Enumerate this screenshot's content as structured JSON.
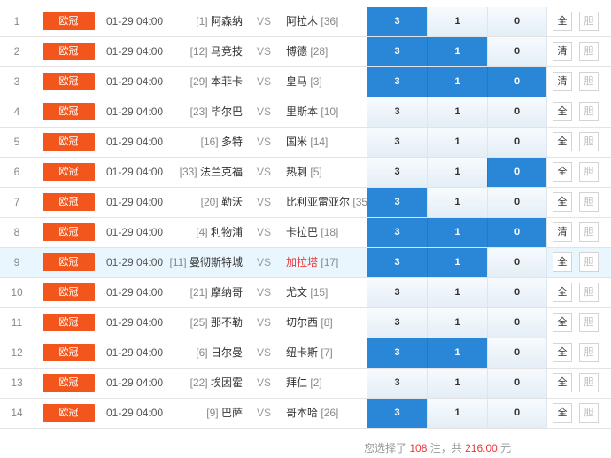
{
  "rows": [
    {
      "idx": "1",
      "league": "欧冠",
      "time": "01-29 04:00",
      "home_rank": "[1]",
      "home": "阿森纳",
      "vs": "VS",
      "away": "阿拉木",
      "away_rank": "[36]",
      "o3": "3",
      "o1": "1",
      "o0": "0",
      "sel": [
        true,
        false,
        false
      ],
      "btn": "全",
      "btn2": "胆",
      "hl": false,
      "away_red": false
    },
    {
      "idx": "2",
      "league": "欧冠",
      "time": "01-29 04:00",
      "home_rank": "[12]",
      "home": "马竞技",
      "vs": "VS",
      "away": "博德",
      "away_rank": "[28]",
      "o3": "3",
      "o1": "1",
      "o0": "0",
      "sel": [
        true,
        true,
        false
      ],
      "btn": "清",
      "btn2": "胆",
      "hl": false,
      "away_red": false
    },
    {
      "idx": "3",
      "league": "欧冠",
      "time": "01-29 04:00",
      "home_rank": "[29]",
      "home": "本菲卡",
      "vs": "VS",
      "away": "皇马",
      "away_rank": "[3]",
      "o3": "3",
      "o1": "1",
      "o0": "0",
      "sel": [
        true,
        true,
        true
      ],
      "btn": "清",
      "btn2": "胆",
      "hl": false,
      "away_red": false
    },
    {
      "idx": "4",
      "league": "欧冠",
      "time": "01-29 04:00",
      "home_rank": "[23]",
      "home": "毕尔巴",
      "vs": "VS",
      "away": "里斯本",
      "away_rank": "[10]",
      "o3": "3",
      "o1": "1",
      "o0": "0",
      "sel": [
        false,
        false,
        false
      ],
      "btn": "全",
      "btn2": "胆",
      "hl": false,
      "away_red": false
    },
    {
      "idx": "5",
      "league": "欧冠",
      "time": "01-29 04:00",
      "home_rank": "[16]",
      "home": "多特",
      "vs": "VS",
      "away": "国米",
      "away_rank": "[14]",
      "o3": "3",
      "o1": "1",
      "o0": "0",
      "sel": [
        false,
        false,
        false
      ],
      "btn": "全",
      "btn2": "胆",
      "hl": false,
      "away_red": false
    },
    {
      "idx": "6",
      "league": "欧冠",
      "time": "01-29 04:00",
      "home_rank": "[33]",
      "home": "法兰克福",
      "vs": "VS",
      "away": "热刺",
      "away_rank": "[5]",
      "o3": "3",
      "o1": "1",
      "o0": "0",
      "sel": [
        false,
        false,
        true
      ],
      "btn": "全",
      "btn2": "胆",
      "hl": false,
      "away_red": false
    },
    {
      "idx": "7",
      "league": "欧冠",
      "time": "01-29 04:00",
      "home_rank": "[20]",
      "home": "勒沃",
      "vs": "VS",
      "away": "比利亚雷亚尔",
      "away_rank": "[35]",
      "o3": "3",
      "o1": "1",
      "o0": "0",
      "sel": [
        true,
        false,
        false
      ],
      "btn": "全",
      "btn2": "胆",
      "hl": false,
      "away_red": false
    },
    {
      "idx": "8",
      "league": "欧冠",
      "time": "01-29 04:00",
      "home_rank": "[4]",
      "home": "利物浦",
      "vs": "VS",
      "away": "卡拉巴",
      "away_rank": "[18]",
      "o3": "3",
      "o1": "1",
      "o0": "0",
      "sel": [
        true,
        true,
        true
      ],
      "btn": "清",
      "btn2": "胆",
      "hl": false,
      "away_red": false
    },
    {
      "idx": "9",
      "league": "欧冠",
      "time": "01-29 04:00",
      "home_rank": "[11]",
      "home": "曼彻斯特城",
      "vs": "VS",
      "away": "加拉塔",
      "away_rank": "[17]",
      "o3": "3",
      "o1": "1",
      "o0": "0",
      "sel": [
        true,
        true,
        false
      ],
      "btn": "全",
      "btn2": "胆",
      "hl": true,
      "away_red": true
    },
    {
      "idx": "10",
      "league": "欧冠",
      "time": "01-29 04:00",
      "home_rank": "[21]",
      "home": "摩纳哥",
      "vs": "VS",
      "away": "尤文",
      "away_rank": "[15]",
      "o3": "3",
      "o1": "1",
      "o0": "0",
      "sel": [
        false,
        false,
        false
      ],
      "btn": "全",
      "btn2": "胆",
      "hl": false,
      "away_red": false
    },
    {
      "idx": "11",
      "league": "欧冠",
      "time": "01-29 04:00",
      "home_rank": "[25]",
      "home": "那不勒",
      "vs": "VS",
      "away": "切尔西",
      "away_rank": "[8]",
      "o3": "3",
      "o1": "1",
      "o0": "0",
      "sel": [
        false,
        false,
        false
      ],
      "btn": "全",
      "btn2": "胆",
      "hl": false,
      "away_red": false
    },
    {
      "idx": "12",
      "league": "欧冠",
      "time": "01-29 04:00",
      "home_rank": "[6]",
      "home": "日尔曼",
      "vs": "VS",
      "away": "纽卡斯",
      "away_rank": "[7]",
      "o3": "3",
      "o1": "1",
      "o0": "0",
      "sel": [
        true,
        true,
        false
      ],
      "btn": "全",
      "btn2": "胆",
      "hl": false,
      "away_red": false
    },
    {
      "idx": "13",
      "league": "欧冠",
      "time": "01-29 04:00",
      "home_rank": "[22]",
      "home": "埃因霍",
      "vs": "VS",
      "away": "拜仁",
      "away_rank": "[2]",
      "o3": "3",
      "o1": "1",
      "o0": "0",
      "sel": [
        false,
        false,
        false
      ],
      "btn": "全",
      "btn2": "胆",
      "hl": false,
      "away_red": false
    },
    {
      "idx": "14",
      "league": "欧冠",
      "time": "01-29 04:00",
      "home_rank": "[9]",
      "home": "巴萨",
      "vs": "VS",
      "away": "哥本哈",
      "away_rank": "[26]",
      "o3": "3",
      "o1": "1",
      "o0": "0",
      "sel": [
        true,
        false,
        false
      ],
      "btn": "全",
      "btn2": "胆",
      "hl": false,
      "away_red": false
    }
  ],
  "footer": {
    "prefix": "您选择了",
    "count": "108",
    "mid": "注，共",
    "amount": "216.00",
    "suffix": "元"
  },
  "colors": {
    "league_badge": "#f2561d",
    "selected_odds": "#2a87d8",
    "highlight_row": "#eaf6fd",
    "accent_red": "#e4393c"
  }
}
